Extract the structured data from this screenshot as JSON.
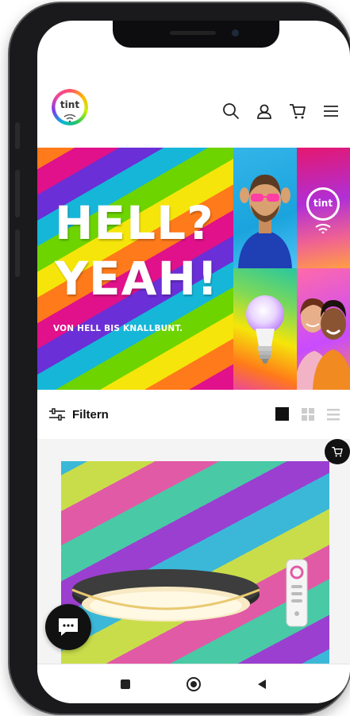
{
  "header": {
    "logo_text": "tint",
    "icons": [
      "search-icon",
      "account-icon",
      "cart-icon",
      "menu-icon"
    ]
  },
  "hero": {
    "headline_line1": "HELL?",
    "headline_line2": "YEAH!",
    "subline": "VON HELL BIS KNALLBUNT.",
    "tile_logo_text": "tint"
  },
  "toolbar": {
    "filter_label": "Filtern",
    "view_modes": [
      "large-grid",
      "grid",
      "list"
    ],
    "active_view": "large-grid"
  },
  "product": {
    "quick_add_icon": "cart-icon"
  },
  "android_nav": {
    "buttons": [
      "recents",
      "home",
      "back"
    ]
  },
  "colors": {
    "accent": "#111111",
    "background": "#ffffff",
    "product_bg": "#f4f4f4"
  }
}
